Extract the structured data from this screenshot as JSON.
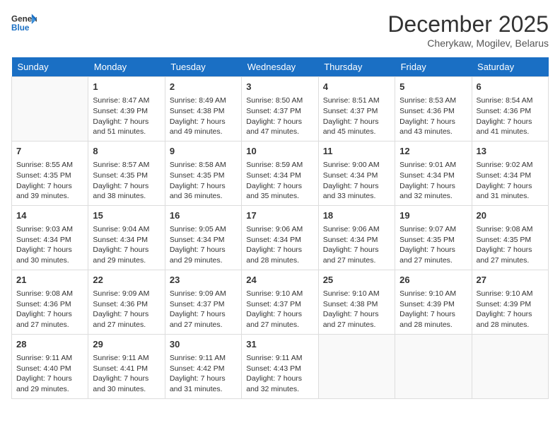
{
  "header": {
    "logo_general": "General",
    "logo_blue": "Blue",
    "month_title": "December 2025",
    "subtitle": "Cherykaw, Mogilev, Belarus"
  },
  "days_of_week": [
    "Sunday",
    "Monday",
    "Tuesday",
    "Wednesday",
    "Thursday",
    "Friday",
    "Saturday"
  ],
  "weeks": [
    [
      {
        "day": "",
        "sunrise": "",
        "sunset": "",
        "daylight": ""
      },
      {
        "day": "1",
        "sunrise": "Sunrise: 8:47 AM",
        "sunset": "Sunset: 4:39 PM",
        "daylight": "Daylight: 7 hours and 51 minutes."
      },
      {
        "day": "2",
        "sunrise": "Sunrise: 8:49 AM",
        "sunset": "Sunset: 4:38 PM",
        "daylight": "Daylight: 7 hours and 49 minutes."
      },
      {
        "day": "3",
        "sunrise": "Sunrise: 8:50 AM",
        "sunset": "Sunset: 4:37 PM",
        "daylight": "Daylight: 7 hours and 47 minutes."
      },
      {
        "day": "4",
        "sunrise": "Sunrise: 8:51 AM",
        "sunset": "Sunset: 4:37 PM",
        "daylight": "Daylight: 7 hours and 45 minutes."
      },
      {
        "day": "5",
        "sunrise": "Sunrise: 8:53 AM",
        "sunset": "Sunset: 4:36 PM",
        "daylight": "Daylight: 7 hours and 43 minutes."
      },
      {
        "day": "6",
        "sunrise": "Sunrise: 8:54 AM",
        "sunset": "Sunset: 4:36 PM",
        "daylight": "Daylight: 7 hours and 41 minutes."
      }
    ],
    [
      {
        "day": "7",
        "sunrise": "Sunrise: 8:55 AM",
        "sunset": "Sunset: 4:35 PM",
        "daylight": "Daylight: 7 hours and 39 minutes."
      },
      {
        "day": "8",
        "sunrise": "Sunrise: 8:57 AM",
        "sunset": "Sunset: 4:35 PM",
        "daylight": "Daylight: 7 hours and 38 minutes."
      },
      {
        "day": "9",
        "sunrise": "Sunrise: 8:58 AM",
        "sunset": "Sunset: 4:35 PM",
        "daylight": "Daylight: 7 hours and 36 minutes."
      },
      {
        "day": "10",
        "sunrise": "Sunrise: 8:59 AM",
        "sunset": "Sunset: 4:34 PM",
        "daylight": "Daylight: 7 hours and 35 minutes."
      },
      {
        "day": "11",
        "sunrise": "Sunrise: 9:00 AM",
        "sunset": "Sunset: 4:34 PM",
        "daylight": "Daylight: 7 hours and 33 minutes."
      },
      {
        "day": "12",
        "sunrise": "Sunrise: 9:01 AM",
        "sunset": "Sunset: 4:34 PM",
        "daylight": "Daylight: 7 hours and 32 minutes."
      },
      {
        "day": "13",
        "sunrise": "Sunrise: 9:02 AM",
        "sunset": "Sunset: 4:34 PM",
        "daylight": "Daylight: 7 hours and 31 minutes."
      }
    ],
    [
      {
        "day": "14",
        "sunrise": "Sunrise: 9:03 AM",
        "sunset": "Sunset: 4:34 PM",
        "daylight": "Daylight: 7 hours and 30 minutes."
      },
      {
        "day": "15",
        "sunrise": "Sunrise: 9:04 AM",
        "sunset": "Sunset: 4:34 PM",
        "daylight": "Daylight: 7 hours and 29 minutes."
      },
      {
        "day": "16",
        "sunrise": "Sunrise: 9:05 AM",
        "sunset": "Sunset: 4:34 PM",
        "daylight": "Daylight: 7 hours and 29 minutes."
      },
      {
        "day": "17",
        "sunrise": "Sunrise: 9:06 AM",
        "sunset": "Sunset: 4:34 PM",
        "daylight": "Daylight: 7 hours and 28 minutes."
      },
      {
        "day": "18",
        "sunrise": "Sunrise: 9:06 AM",
        "sunset": "Sunset: 4:34 PM",
        "daylight": "Daylight: 7 hours and 27 minutes."
      },
      {
        "day": "19",
        "sunrise": "Sunrise: 9:07 AM",
        "sunset": "Sunset: 4:35 PM",
        "daylight": "Daylight: 7 hours and 27 minutes."
      },
      {
        "day": "20",
        "sunrise": "Sunrise: 9:08 AM",
        "sunset": "Sunset: 4:35 PM",
        "daylight": "Daylight: 7 hours and 27 minutes."
      }
    ],
    [
      {
        "day": "21",
        "sunrise": "Sunrise: 9:08 AM",
        "sunset": "Sunset: 4:36 PM",
        "daylight": "Daylight: 7 hours and 27 minutes."
      },
      {
        "day": "22",
        "sunrise": "Sunrise: 9:09 AM",
        "sunset": "Sunset: 4:36 PM",
        "daylight": "Daylight: 7 hours and 27 minutes."
      },
      {
        "day": "23",
        "sunrise": "Sunrise: 9:09 AM",
        "sunset": "Sunset: 4:37 PM",
        "daylight": "Daylight: 7 hours and 27 minutes."
      },
      {
        "day": "24",
        "sunrise": "Sunrise: 9:10 AM",
        "sunset": "Sunset: 4:37 PM",
        "daylight": "Daylight: 7 hours and 27 minutes."
      },
      {
        "day": "25",
        "sunrise": "Sunrise: 9:10 AM",
        "sunset": "Sunset: 4:38 PM",
        "daylight": "Daylight: 7 hours and 27 minutes."
      },
      {
        "day": "26",
        "sunrise": "Sunrise: 9:10 AM",
        "sunset": "Sunset: 4:39 PM",
        "daylight": "Daylight: 7 hours and 28 minutes."
      },
      {
        "day": "27",
        "sunrise": "Sunrise: 9:10 AM",
        "sunset": "Sunset: 4:39 PM",
        "daylight": "Daylight: 7 hours and 28 minutes."
      }
    ],
    [
      {
        "day": "28",
        "sunrise": "Sunrise: 9:11 AM",
        "sunset": "Sunset: 4:40 PM",
        "daylight": "Daylight: 7 hours and 29 minutes."
      },
      {
        "day": "29",
        "sunrise": "Sunrise: 9:11 AM",
        "sunset": "Sunset: 4:41 PM",
        "daylight": "Daylight: 7 hours and 30 minutes."
      },
      {
        "day": "30",
        "sunrise": "Sunrise: 9:11 AM",
        "sunset": "Sunset: 4:42 PM",
        "daylight": "Daylight: 7 hours and 31 minutes."
      },
      {
        "day": "31",
        "sunrise": "Sunrise: 9:11 AM",
        "sunset": "Sunset: 4:43 PM",
        "daylight": "Daylight: 7 hours and 32 minutes."
      },
      {
        "day": "",
        "sunrise": "",
        "sunset": "",
        "daylight": ""
      },
      {
        "day": "",
        "sunrise": "",
        "sunset": "",
        "daylight": ""
      },
      {
        "day": "",
        "sunrise": "",
        "sunset": "",
        "daylight": ""
      }
    ]
  ]
}
